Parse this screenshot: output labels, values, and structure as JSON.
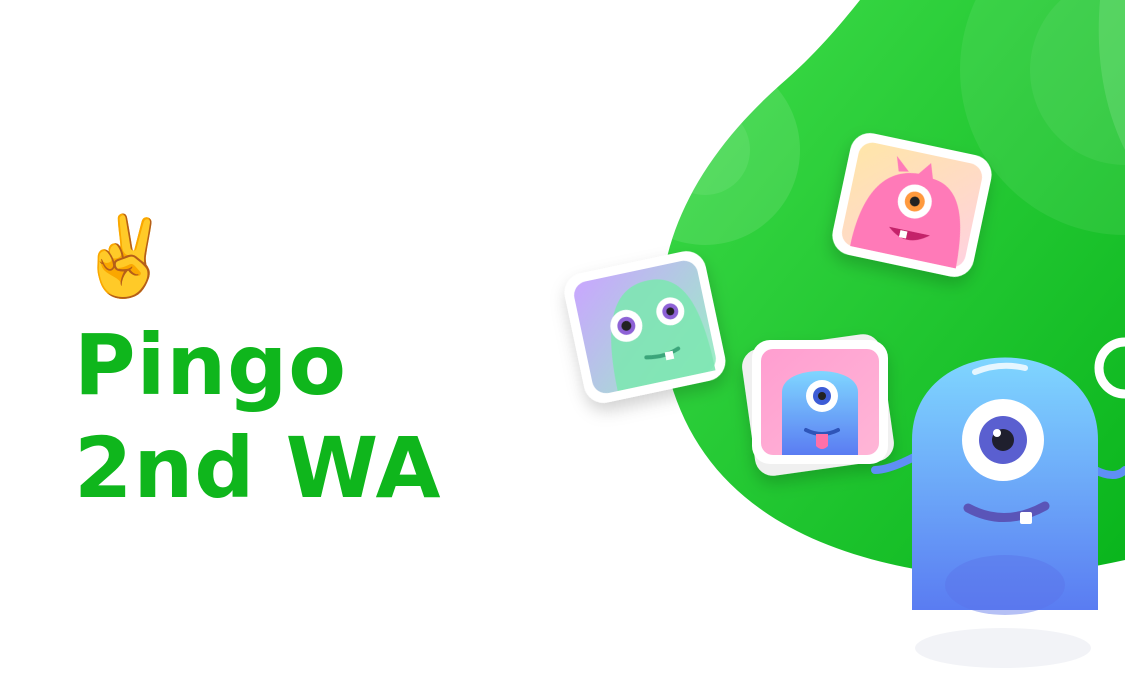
{
  "hero": {
    "emoji": "✌️",
    "title_line_1": "Pingo",
    "title_line_2": "2nd WA"
  },
  "colors": {
    "brand_green": "#0fb61c",
    "blob_green": "#19c22b",
    "monster_blue": "#6aa6ff",
    "monster_pink": "#ff7ab8"
  },
  "icons": [
    "peace-hand-icon",
    "green-monster-sticker",
    "pink-monster-sticker",
    "blue-monster-sticker",
    "blue-mascot-illustration"
  ]
}
